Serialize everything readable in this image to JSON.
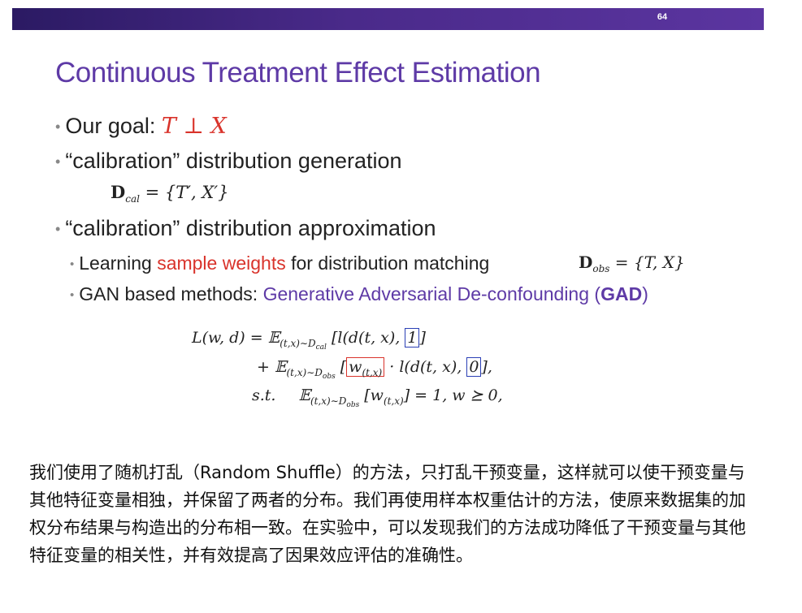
{
  "slide": {
    "page_number": "64",
    "title": "Continuous Treatment Effect Estimation",
    "bullet1": {
      "prefix": "Our goal: ",
      "formula": "T ⊥ X"
    },
    "bullet2": {
      "text": "“calibration” distribution generation",
      "formula_D": "D",
      "formula_sub": "cal",
      "formula_rest": " = {T′, X′}"
    },
    "bullet3": {
      "text": "“calibration” distribution approximation"
    },
    "sub1": {
      "prefix": "Learning ",
      "highlight": "sample weights",
      "suffix": " for distribution matching",
      "formula_D": "D",
      "formula_sub": "obs",
      "formula_rest": " = {T, X}"
    },
    "sub2": {
      "prefix": "GAN based methods: ",
      "highlight": "Generative Adversarial De-confounding (",
      "bold": "GAD",
      "close": ")"
    },
    "equation": {
      "l1_lhs": "L(w, d) = 𝔼",
      "l1_sub": "(t,x)∼D",
      "l1_subsub": "cal",
      "l1_mid": " [l(d(t, x), ",
      "l1_box": "1",
      "l1_end": "]",
      "l2_lhs": "+ 𝔼",
      "l2_sub": "(t,x)∼D",
      "l2_subsub": "obs",
      "l2_open": " [",
      "l2_box": "w",
      "l2_boxsub": "(t,x)",
      "l2_mid": " · l(d(t, x), ",
      "l2_box2": "0",
      "l2_end": "],",
      "l3_st": "s.t.",
      "l3_e": "𝔼",
      "l3_sub": "(t,x)∼D",
      "l3_subsub": "obs",
      "l3_mid": " [w",
      "l3_wsub": "(t,x)",
      "l3_end": "] = 1, w ⪰ 0,"
    }
  },
  "caption": "我们使用了随机打乱（Random Shuffle）的方法，只打乱干预变量，这样就可以使干预变量与其他特征变量相独，并保留了两者的分布。我们再使用样本权重估计的方法，使原来数据集的加权分布结果与构造出的分布相一致。在实验中，可以发现我们的方法成功降低了干预变量与其他特征变量的相关性，并有效提高了因果效应评估的准确性。",
  "colors": {
    "bar": "#4a2a8a",
    "title": "#5e3aa6",
    "highlight_red": "#d9332b",
    "box_blue": "#2a3fb5"
  }
}
